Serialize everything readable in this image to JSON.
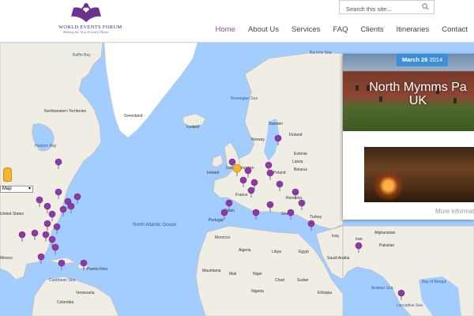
{
  "brand": {
    "name": "WORLD EVENTS FORUM",
    "tagline": "Making the Next Event(s) Better"
  },
  "search": {
    "placeholder": "Search this site...",
    "icon": "search-icon"
  },
  "nav": {
    "items": [
      {
        "label": "Home",
        "active": true
      },
      {
        "label": "About Us",
        "active": false
      },
      {
        "label": "Services",
        "active": false
      },
      {
        "label": "FAQ",
        "active": false
      },
      {
        "label": "Clients",
        "active": false
      },
      {
        "label": "Itineraries",
        "active": false
      },
      {
        "label": "Contact",
        "active": false
      }
    ]
  },
  "map": {
    "type_control": "Map",
    "labels": {
      "greenland": "Greenland",
      "iceland": "Iceland",
      "sweden": "Sweden",
      "finland": "Finland",
      "norway": "Norway",
      "estonia": "Estonia",
      "latvia": "Latvia",
      "belarus": "Belarus",
      "poland": "Poland",
      "ireland": "Ireland",
      "united_kingdom": "United Kingdom",
      "france": "France",
      "spain": "Spain",
      "portugal": "Portugal",
      "romania": "Romania",
      "greece": "Greece",
      "turkey": "Turkey",
      "morocco": "Morocco",
      "algeria": "Algeria",
      "libya": "Libya",
      "egypt": "Egypt",
      "mali": "Mali",
      "mauritania": "Mauritania",
      "niger": "Niger",
      "chad": "Chad",
      "sudan": "Sudan",
      "nigeria": "Nigeria",
      "ethiopia": "Ethiopia",
      "saudi_arabia": "Saudi Arabia",
      "iraq": "Iraq",
      "iran": "Iran",
      "afghanistan": "Afghanistan",
      "pakistan": "Pakistan",
      "mexico": "Mexico",
      "venezuela": "Venezuela",
      "colombia": "Colombia",
      "puerto_rico": "Puerto Rico",
      "united_states": "United States",
      "north_atlantic_ocean": "North Atlantic Ocean",
      "caribbean_sea": "Caribbean Sea",
      "hudson_bay": "Hudson Bay",
      "baffin_bay": "Baffin Bay",
      "norwegian_sea": "Norwegian Sea",
      "barents_sea": "Barents Sea",
      "arabian_sea": "Arabian Sea",
      "bay_of_bengal": "Bay of Bengal",
      "northwest_territories": "Northwestern Territories",
      "laccadive_sea": "Laccadive Sea"
    },
    "selected_marker_color": "#f2b632",
    "marker_color": "#8e3aa6"
  },
  "event_panel": {
    "date": "March 26",
    "year": "2014",
    "title": "North Mymms Pa",
    "subtitle": "UK",
    "more": "More informati"
  }
}
